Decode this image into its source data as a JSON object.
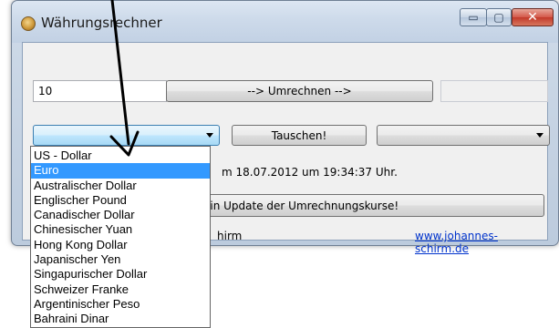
{
  "window": {
    "title": "Währungsrechner",
    "controls": {
      "minimize": "▭",
      "maximize": "▢",
      "close": "✕"
    }
  },
  "converter": {
    "amount_value": "10",
    "convert_label": "-->  Umrechnen  -->",
    "result_value": "",
    "swap_label": "Tauschen!",
    "from_currency_selected": "",
    "to_currency_selected": ""
  },
  "status": {
    "last_update_text": "m 18.07.2012 um 19:34:37 Uhr.",
    "update_button_label": "ein Update der Umrechnungskurse!",
    "author_text": "hirm",
    "website_link": "www.johannes-schirm.de"
  },
  "dropdown": {
    "selected_index": 1,
    "items": [
      "US - Dollar",
      "Euro",
      "Australischer Dollar",
      "Englischer Pound",
      "Canadischer Dollar",
      "Chinesischer Yuan",
      "Hong Kong Dollar",
      "Japanischer Yen",
      "Singapurischer Dollar",
      "Schweizer Franke",
      "Argentinischer Peso",
      "Bahraini Dinar"
    ]
  },
  "colors": {
    "selection": "#3399ff",
    "link": "#0033cc",
    "annotation_arrow": "#000000"
  },
  "icons": {
    "app": "coin-icon",
    "dropdown_arrow": "chevron-down-icon",
    "annotation": "pointer-arrow-icon"
  }
}
